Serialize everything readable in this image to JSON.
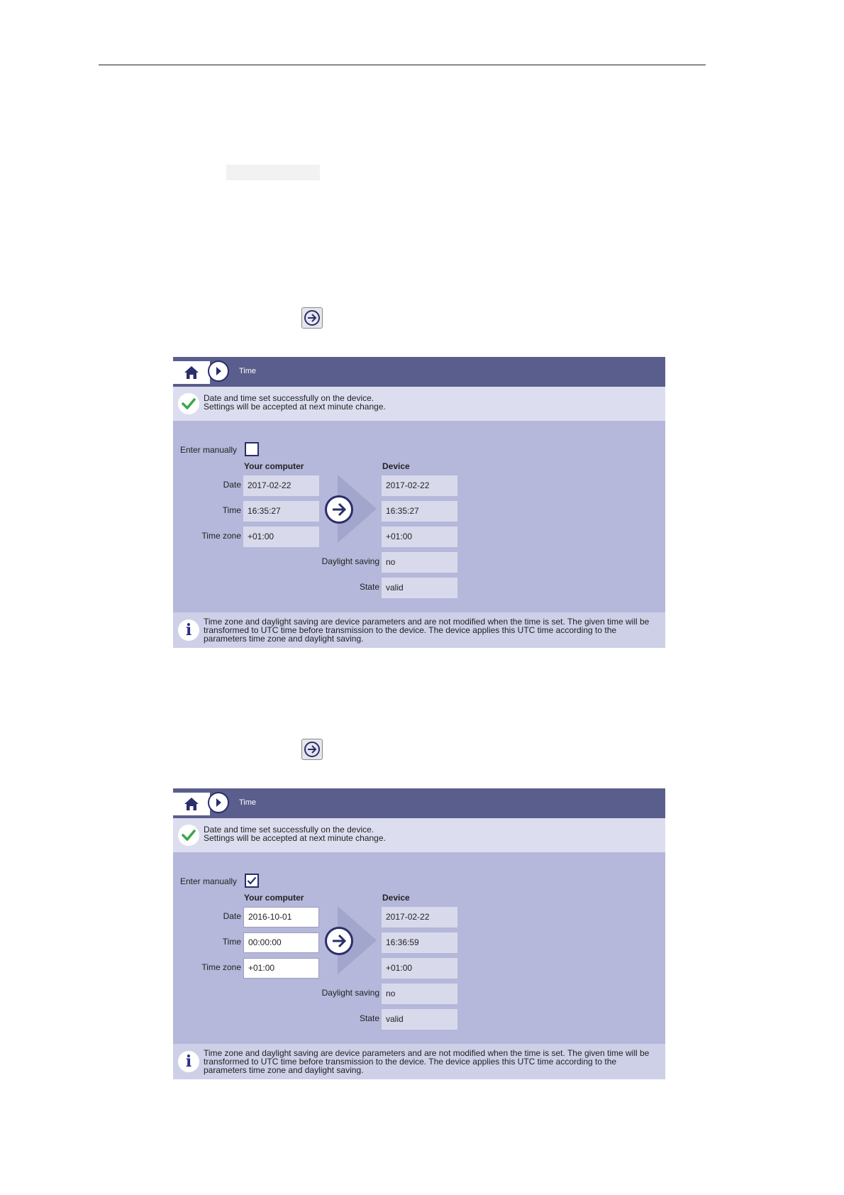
{
  "panels": [
    {
      "header_title": "Time",
      "message_line1": "Date and time set successfully on the device.",
      "message_line2": "Settings will be accepted at next minute change.",
      "enter_manually_label": "Enter manually",
      "enter_manually_checked": false,
      "col_computer": "Your computer",
      "col_device": "Device",
      "date_label": "Date",
      "time_label": "Time",
      "timezone_label": "Time zone",
      "dst_label": "Daylight saving",
      "state_label": "State",
      "computer_date": "2017-02-22",
      "computer_time": "16:35:27",
      "computer_timezone": "+01:00",
      "device_date": "2017-02-22",
      "device_time": "16:35:27",
      "device_timezone": "+01:00",
      "device_dst": "no",
      "device_state": "valid",
      "info_text": "Time zone and daylight saving are device parameters and are not modified when the time is set. The given time will be transformed to UTC time before transmission to the device. The device applies this UTC time according to the parameters time zone and daylight saving."
    },
    {
      "header_title": "Time",
      "message_line1": "Date and time set successfully on the device.",
      "message_line2": "Settings will be accepted at next minute change.",
      "enter_manually_label": "Enter manually",
      "enter_manually_checked": true,
      "col_computer": "Your computer",
      "col_device": "Device",
      "date_label": "Date",
      "time_label": "Time",
      "timezone_label": "Time zone",
      "dst_label": "Daylight saving",
      "state_label": "State",
      "computer_date": "2016-10-01",
      "computer_time": "00:00:00",
      "computer_timezone": "+01:00",
      "device_date": "2017-02-22",
      "device_time": "16:36:59",
      "device_timezone": "+01:00",
      "device_dst": "no",
      "device_state": "valid",
      "info_text": "Time zone and daylight saving are device parameters and are not modified when the time is set. The given time will be transformed to UTC time before transmission to the device. The device applies this UTC time according to the parameters time zone and daylight saving."
    }
  ],
  "colors": {
    "header": "#5a5e8c",
    "panel_body": "#b5b8da",
    "message_bar": "#dcdef0",
    "readonly_field": "#d8daec",
    "icon_navy": "#2a2e6a",
    "success_green": "#3aa84a"
  },
  "icons": {
    "home": "home-icon",
    "nav": "chevron-right-icon",
    "success": "check-icon",
    "transfer": "arrow-right-circle-icon",
    "info": "info-icon"
  }
}
